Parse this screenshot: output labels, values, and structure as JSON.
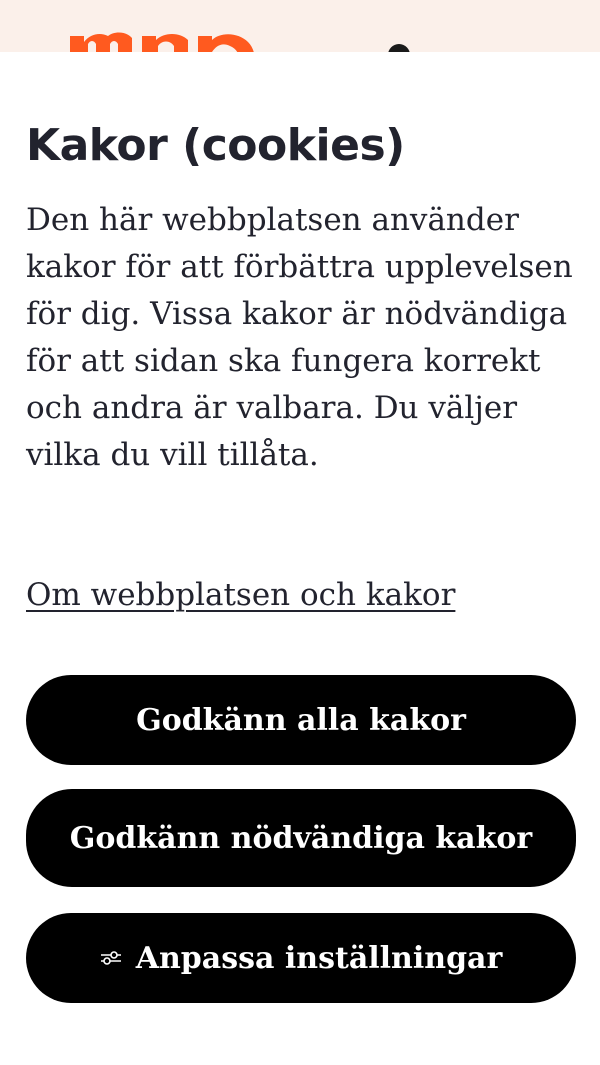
{
  "dialog": {
    "title": "Kakor (cookies)",
    "description": "Den här webbplatsen använder kakor för att förbättra upplevelsen för dig. Vissa kakor är nödvändiga för att sidan ska fungera korrekt och andra är valbara. Du väljer vilka du vill tillåta.",
    "about_link": "Om webbplatsen och kakor",
    "buttons": {
      "accept_all": "Godkänn alla kakor",
      "accept_necessary": "Godkänn nödvändiga kakor",
      "customize": "Anpassa inställningar"
    }
  },
  "icons": {
    "logo": "mp-logo",
    "customize": "sliders-icon"
  },
  "colors": {
    "brand": "#ff5a1f",
    "header_bg": "#fbf0ea",
    "text": "#22232e",
    "button_bg": "#000000",
    "button_text": "#ffffff"
  }
}
